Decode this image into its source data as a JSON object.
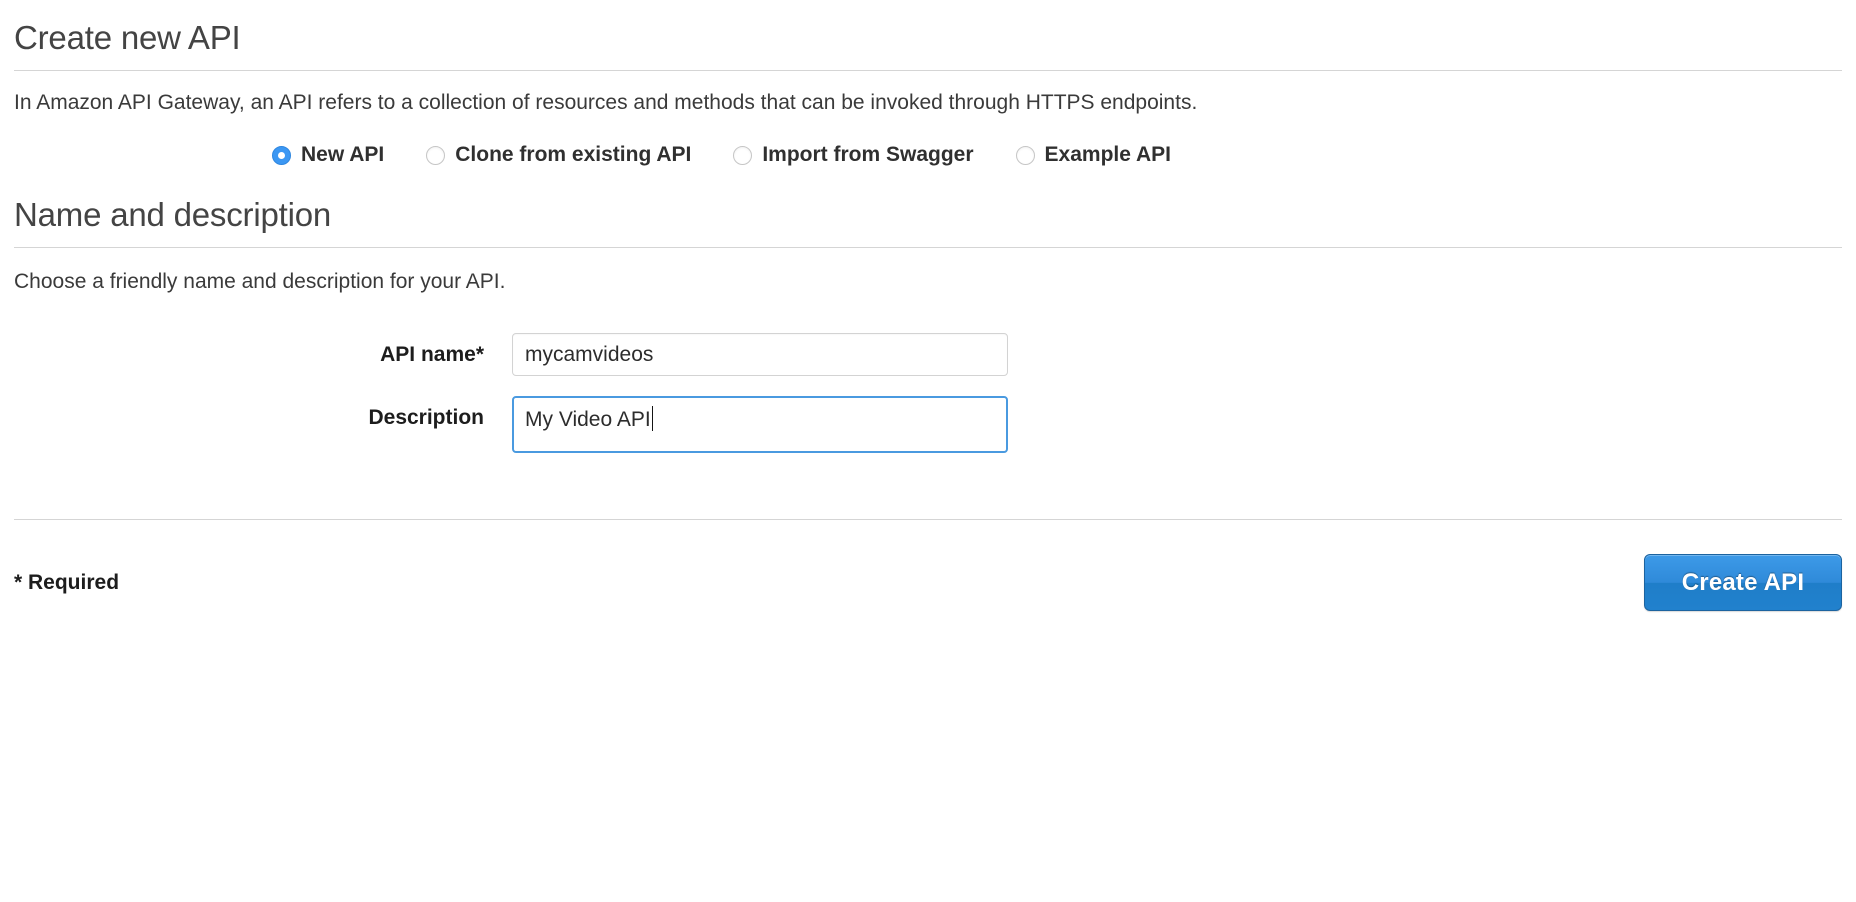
{
  "header": {
    "title": "Create new API",
    "intro": "In Amazon API Gateway, an API refers to a collection of resources and methods that can be invoked through HTTPS endpoints."
  },
  "api_source": {
    "options": [
      {
        "label": "New API",
        "selected": true
      },
      {
        "label": "Clone from existing API",
        "selected": false
      },
      {
        "label": "Import from Swagger",
        "selected": false
      },
      {
        "label": "Example API",
        "selected": false
      }
    ]
  },
  "name_section": {
    "title": "Name and description",
    "hint": "Choose a friendly name and description for your API.",
    "fields": {
      "api_name": {
        "label": "API name*",
        "value": "mycamvideos",
        "placeholder": ""
      },
      "description": {
        "label": "Description",
        "value": "My Video API",
        "placeholder": "",
        "focused": true
      }
    }
  },
  "footer": {
    "required_note": "* Required",
    "create_label": "Create API"
  },
  "colors": {
    "accent": "#3b97f3",
    "button_blue": "#2f8ad9",
    "button_border": "#1c639f",
    "focus_border": "#4a9ae0",
    "rule": "#d5d5d5",
    "text": "#333333"
  }
}
